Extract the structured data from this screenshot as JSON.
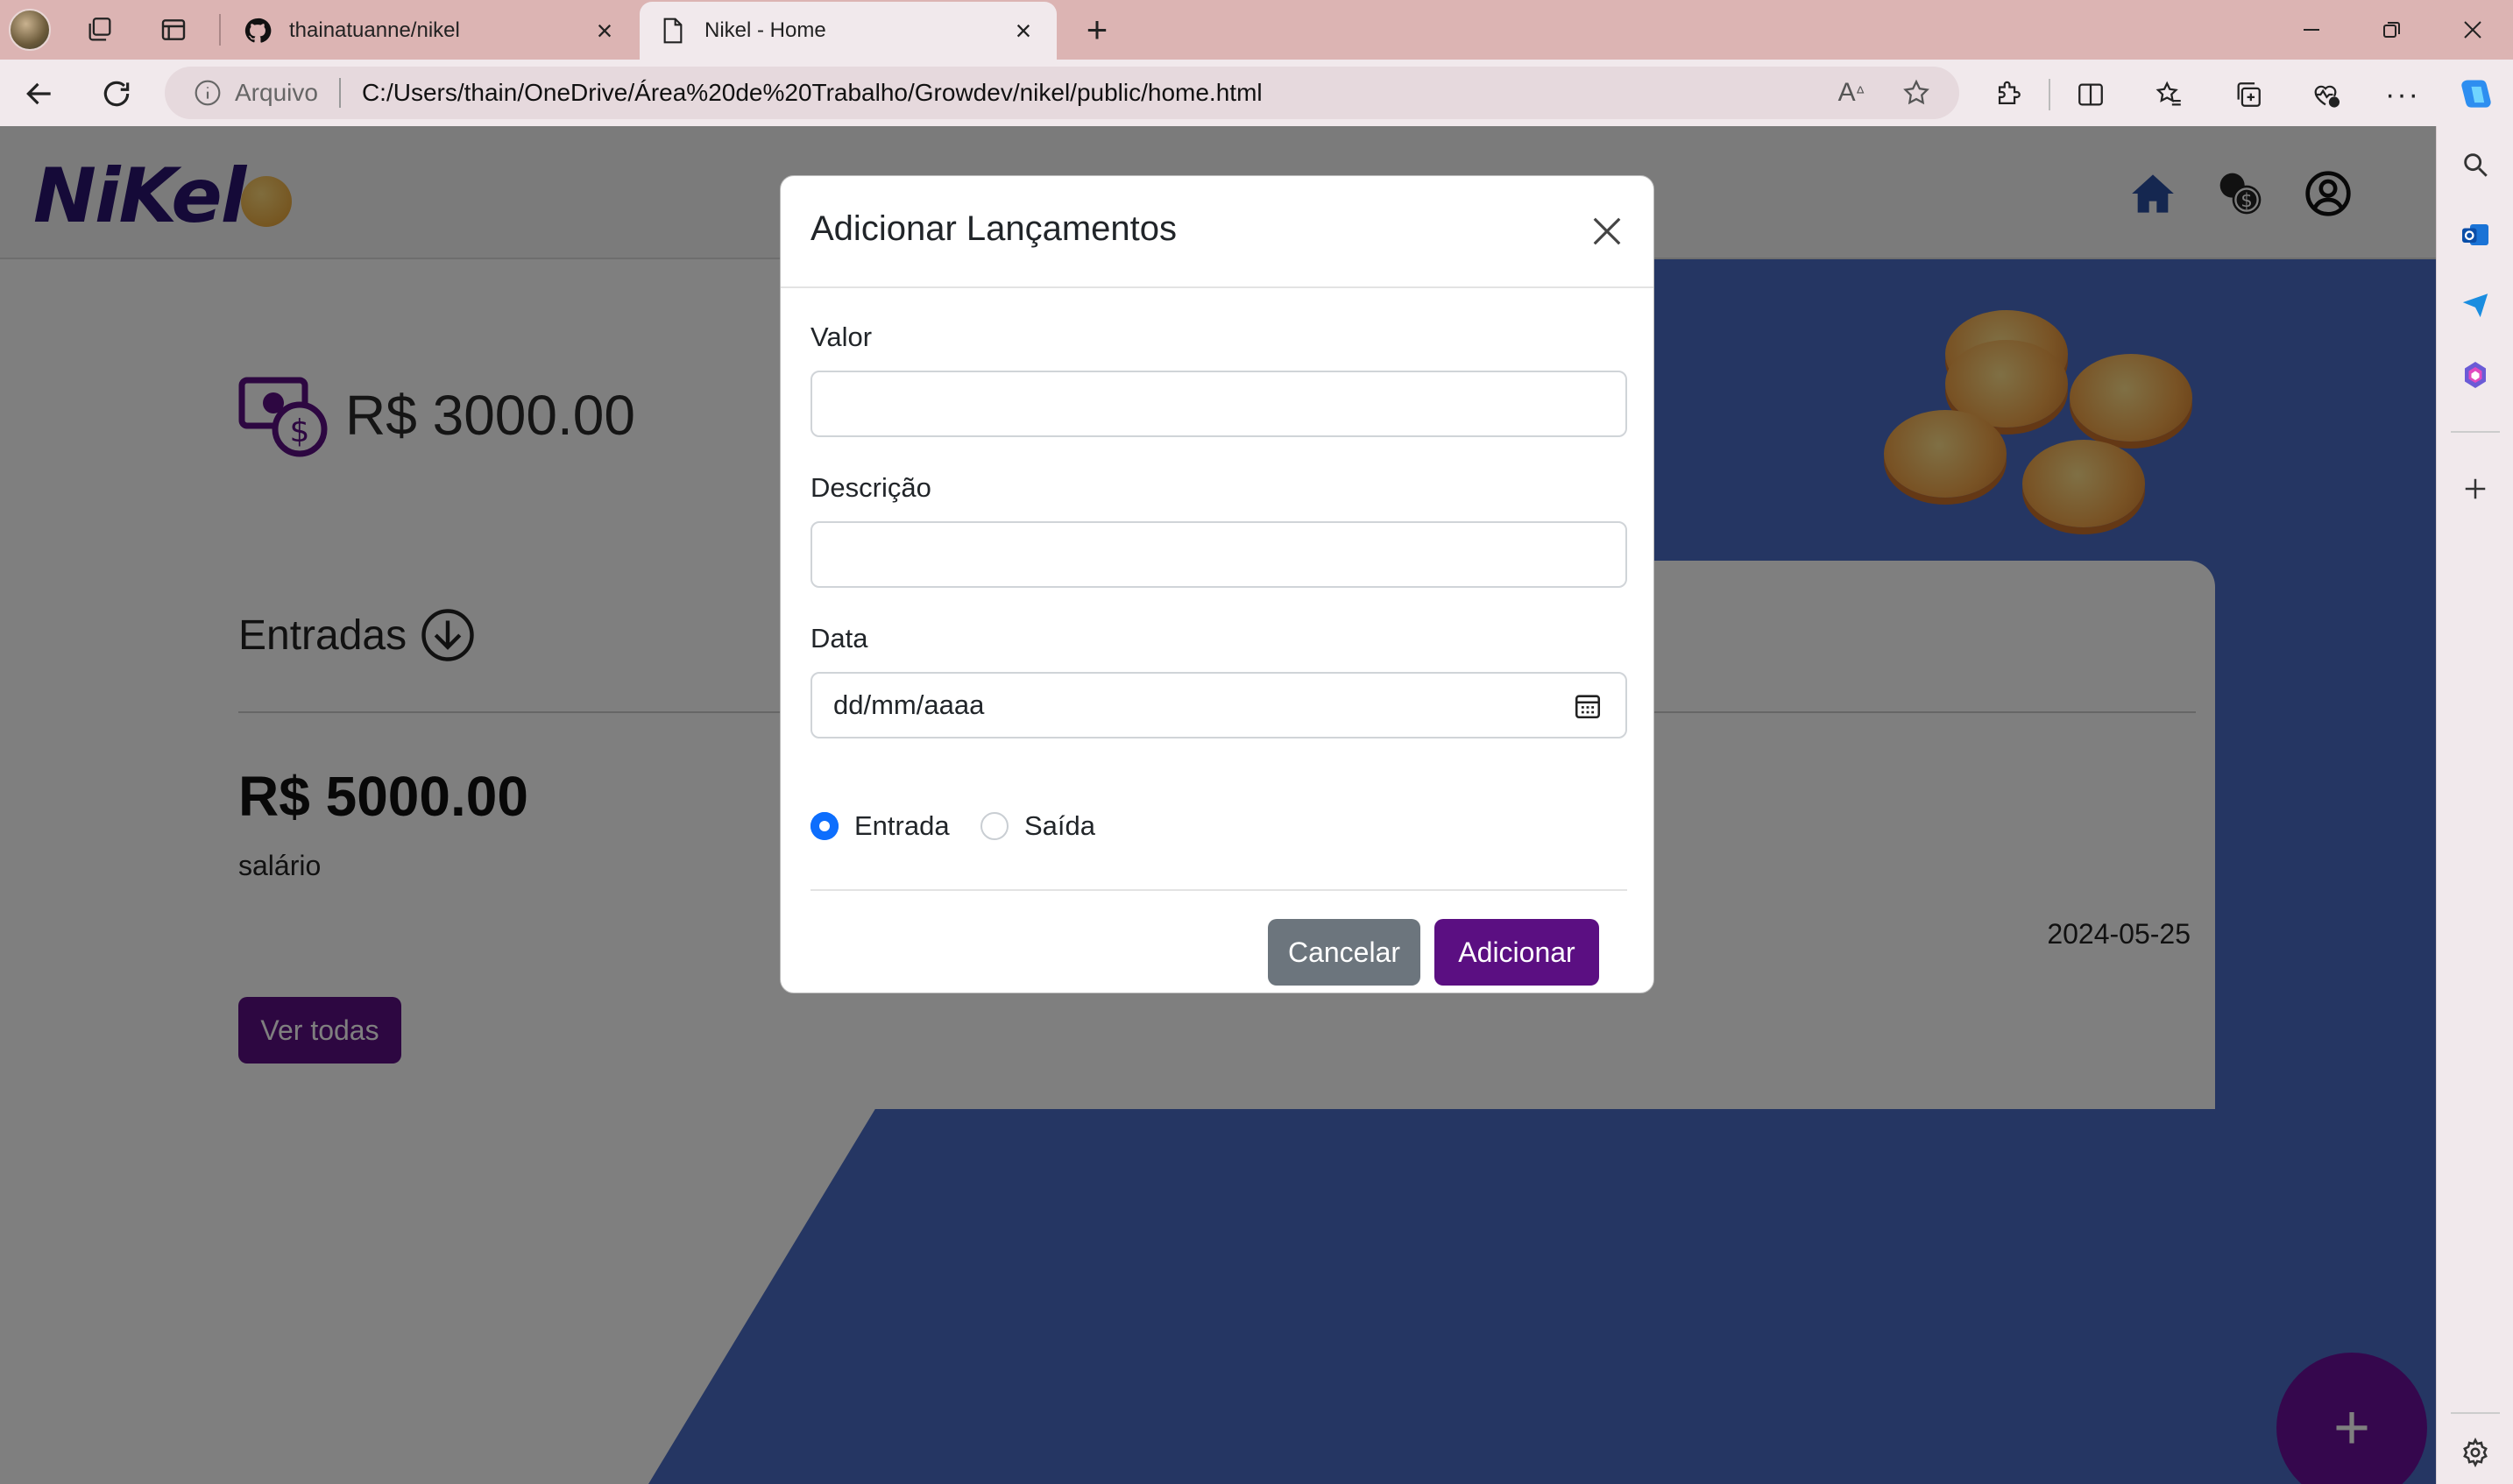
{
  "browser": {
    "tabs": [
      {
        "title": "thainatuanne/nikel",
        "active": false
      },
      {
        "title": "Nikel - Home",
        "active": true
      }
    ],
    "address": {
      "prefix": "Arquivo",
      "url": "C:/Users/thain/OneDrive/Área%20de%20Trabalho/Growdev/nikel/public/home.html"
    }
  },
  "app": {
    "logo": "NiKel",
    "balance": "R$ 3000.00",
    "card": {
      "title": "Entradas",
      "amount": "R$ 5000.00",
      "description": "salário",
      "date": "2024-05-25",
      "view_all": "Ver todas"
    },
    "fab": "+"
  },
  "modal": {
    "title": "Adicionar Lançamentos",
    "fields": {
      "valor": {
        "label": "Valor",
        "value": ""
      },
      "descricao": {
        "label": "Descrição",
        "value": ""
      },
      "data": {
        "label": "Data",
        "placeholder": "dd/mm/aaaa"
      }
    },
    "type": {
      "options": [
        "Entrada",
        "Saída"
      ],
      "selected": "Entrada"
    },
    "buttons": {
      "cancel": "Cancelar",
      "add": "Adicionar"
    }
  },
  "colors": {
    "accent": "#5b0f82",
    "background_blue": "#4a6dc7",
    "radio": "#0d6efd",
    "cancel": "#6c757d"
  }
}
